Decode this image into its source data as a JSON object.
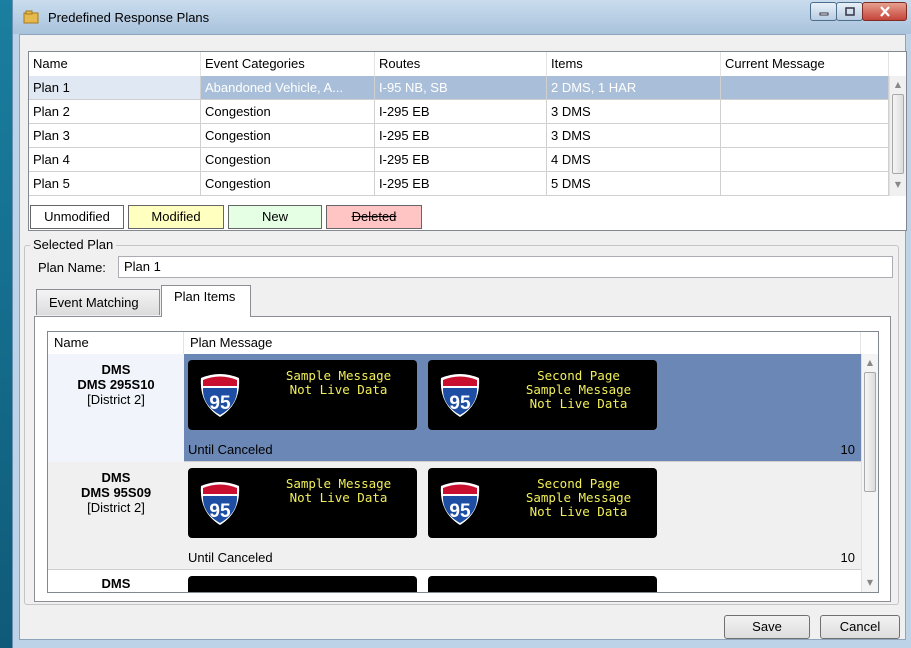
{
  "window": {
    "title": "Predefined Response Plans"
  },
  "plans_grid": {
    "columns": [
      "Name",
      "Event Categories",
      "Routes",
      "Items",
      "Current Message"
    ],
    "rows": [
      {
        "name": "Plan 1",
        "categories": "Abandoned Vehicle, A...",
        "routes": "I-95 NB, SB",
        "items": "2 DMS, 1 HAR",
        "message": ""
      },
      {
        "name": "Plan 2",
        "categories": "Congestion",
        "routes": "I-295 EB",
        "items": "3 DMS",
        "message": ""
      },
      {
        "name": "Plan 3",
        "categories": "Congestion",
        "routes": "I-295 EB",
        "items": "3 DMS",
        "message": ""
      },
      {
        "name": "Plan 4",
        "categories": "Congestion",
        "routes": "I-295 EB",
        "items": "4 DMS",
        "message": ""
      },
      {
        "name": "Plan 5",
        "categories": "Congestion",
        "routes": "I-295 EB",
        "items": "5 DMS",
        "message": ""
      }
    ]
  },
  "legend": {
    "unmodified": "Unmodified",
    "modified": "Modified",
    "new": "New",
    "deleted": "Deleted"
  },
  "selected_plan": {
    "group_title": "Selected Plan",
    "plan_name_label": "Plan Name:",
    "plan_name_value": "Plan 1",
    "tabs": [
      "Event Matching",
      "Plan Items"
    ]
  },
  "plan_items": {
    "columns": [
      "Name",
      "Plan Message"
    ],
    "rows": [
      {
        "type": "DMS",
        "device": "DMS 295S10",
        "district": "[District 2]",
        "page1": "Sample Message\nNot Live Data",
        "page2": "Second Page\nSample Message\nNot Live Data",
        "duration": "Until Canceled",
        "priority": "10"
      },
      {
        "type": "DMS",
        "device": "DMS 95S09",
        "district": "[District 2]",
        "page1": "Sample Message\nNot Live Data",
        "page2": "Second Page\nSample Message\nNot Live Data",
        "duration": "Until Canceled",
        "priority": "10"
      },
      {
        "type": "DMS"
      }
    ],
    "shield_number": "95"
  },
  "buttons": {
    "save": "Save",
    "cancel": "Cancel"
  },
  "colors": {
    "legend_modified": "#ffffc0",
    "legend_new": "#e4ffe4",
    "legend_deleted": "#ffc4c4",
    "selected_item_row": "#6a87b5",
    "sign_text": "#f2ef5a"
  }
}
